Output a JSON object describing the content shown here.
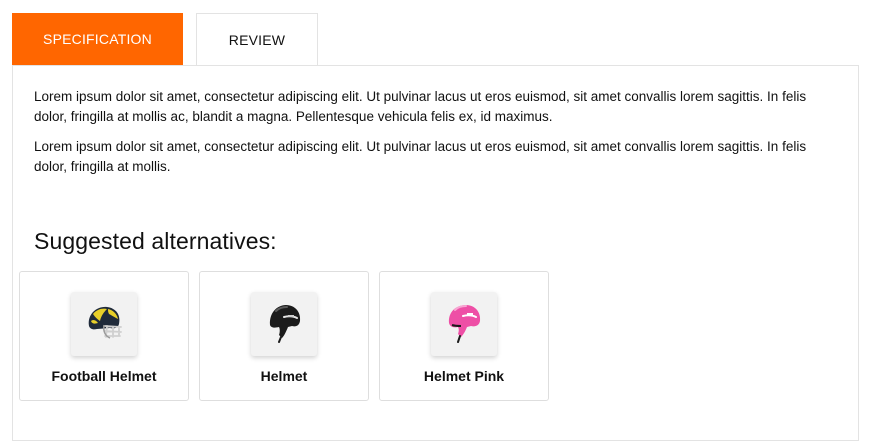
{
  "tabs": [
    {
      "label": "SPECIFICATION",
      "active": true
    },
    {
      "label": "REVIEW",
      "active": false
    }
  ],
  "description": {
    "paragraphs": [
      "Lorem ipsum dolor sit amet, consectetur adipiscing elit. Ut pulvinar lacus ut eros euismod, sit amet convallis lorem sagittis. In felis dolor, fringilla at mollis ac, blandit a magna. Pellentesque vehicula felis ex, id maximus.",
      "Lorem ipsum dolor sit amet, consectetur adipiscing elit. Ut pulvinar lacus ut eros euismod, sit amet convallis lorem sagittis. In felis dolor, fringilla at mollis."
    ]
  },
  "suggestions": {
    "title": "Suggested alternatives:",
    "items": [
      {
        "name": "Football Helmet",
        "icon": "football-helmet-icon"
      },
      {
        "name": "Helmet",
        "icon": "ski-helmet-icon"
      },
      {
        "name": "Helmet Pink",
        "icon": "pink-helmet-icon"
      }
    ]
  },
  "colors": {
    "accent": "#ff6600",
    "border": "#e3e3e3",
    "text": "#111111"
  }
}
